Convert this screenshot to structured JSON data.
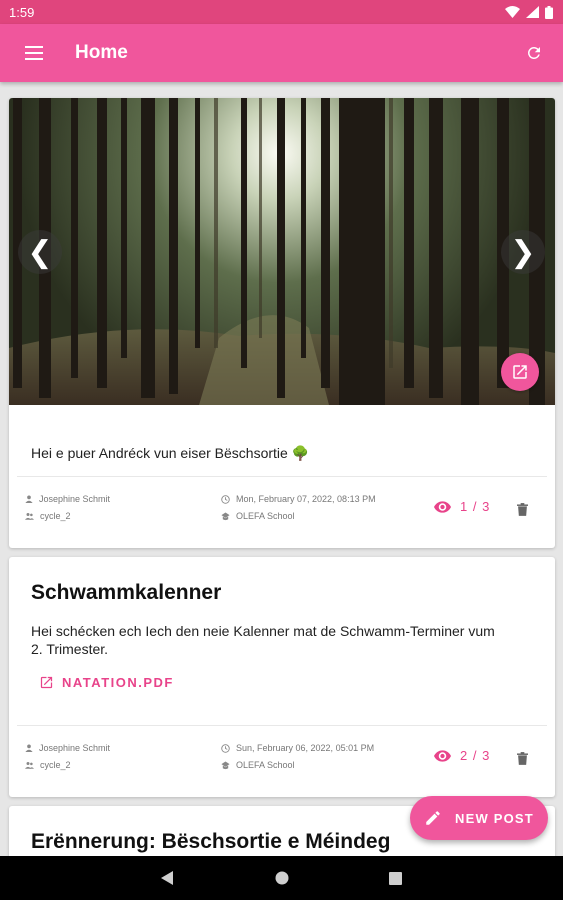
{
  "status_bar": {
    "time": "1:59"
  },
  "app_bar": {
    "title": "Home"
  },
  "posts": [
    {
      "body": "Hei e puer Andréck vun eiser Bëschsortie 🌳",
      "author": "Josephine Schmit",
      "group": "cycle_2",
      "date": "Mon, February 07, 2022, 08:13 PM",
      "school": "OLEFA School",
      "views": "1 / 3"
    },
    {
      "title": "Schwammkalenner",
      "body_line1": "Hei schécken ech Iech den neie Kalenner mat de Schwamm-Terminer vum",
      "body_line2": "2. Trimester.",
      "attachment": "NATATION.PDF",
      "author": "Josephine Schmit",
      "group": "cycle_2",
      "date": "Sun, February 06, 2022, 05:01 PM",
      "school": "OLEFA School",
      "views": "2 / 3"
    },
    {
      "title": "Erënnerung: Bëschsortie e Méindeg"
    }
  ],
  "fab": {
    "label": "NEW POST"
  },
  "icons": {
    "menu": "menu-icon",
    "refresh": "refresh-icon",
    "eye": "eye-icon",
    "trash": "trash-icon",
    "open_external": "open-external-icon",
    "pencil": "pencil-icon"
  },
  "colors": {
    "accent": "#f0569c",
    "status_bar": "#e0457d",
    "accent_text": "#e8438a"
  }
}
